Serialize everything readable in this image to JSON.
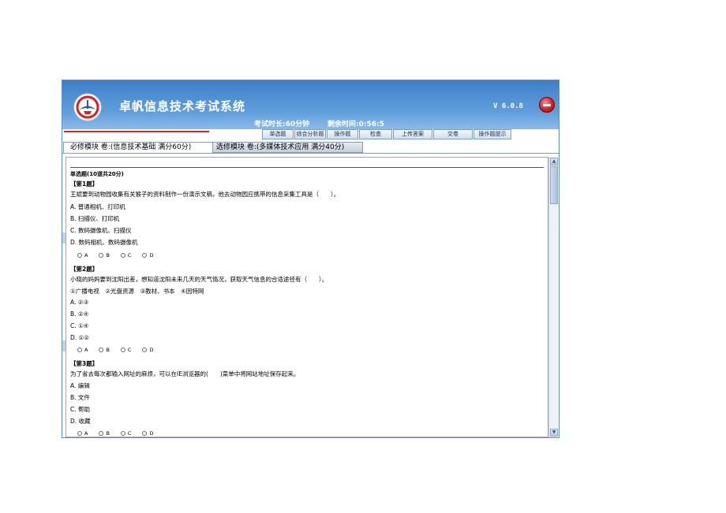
{
  "app": {
    "title": "卓帆信息技术考试系统",
    "version": "V 6.0.8",
    "exam_duration": "考试时长:60分钟",
    "remaining_time": "剩余时间:0:56:5"
  },
  "toolbar": {
    "buttons": [
      "单选题",
      "综合分析题",
      "操作题",
      "检查",
      "上传答案",
      "交卷",
      "操作题提示"
    ]
  },
  "tabs": {
    "required": "必修模块 卷:(信息技术基础 满分60分)",
    "elective": "选修模块 卷:(多媒体技术应用 满分40分)"
  },
  "section": {
    "title": "单选题(10道共20分)"
  },
  "questions": [
    {
      "number": "【第1题】",
      "stem": "王斌要到动物园收集有关猴子的资料制作一份演示文稿，他去动物园应携带的信息采集工具是（　　）。",
      "extra": "",
      "options": [
        "A. 普通相机、打印机",
        "B. 扫描仪、打印机",
        "C. 数码摄像机、扫描仪",
        "D. 数码相机、数码摄像机"
      ]
    },
    {
      "number": "【第2题】",
      "stem": "小晓的妈妈要到沈阳出差，想知道沈阳未来几天的天气情况，获取天气信息的合适途径有（　　）。",
      "extra": "①广播电视　②光盘资源　③教材、书本　④因特网",
      "options": [
        "A. ②③",
        "B. ②④",
        "C. ①④",
        "D. ①②"
      ]
    },
    {
      "number": "【第3题】",
      "stem": "为了省去每次都输入网址的麻烦，可以在IE浏览器的(　　)菜单中将网站地址保存起来。",
      "extra": "",
      "options": [
        "A. 编辑",
        "B. 文件",
        "C. 帮助",
        "D. 收藏"
      ]
    }
  ],
  "answer_choices": [
    "A",
    "B",
    "C",
    "D"
  ],
  "colors": {
    "header": "#4a8bd0",
    "accent_line": "#e02020",
    "close_button": "#d62020"
  }
}
